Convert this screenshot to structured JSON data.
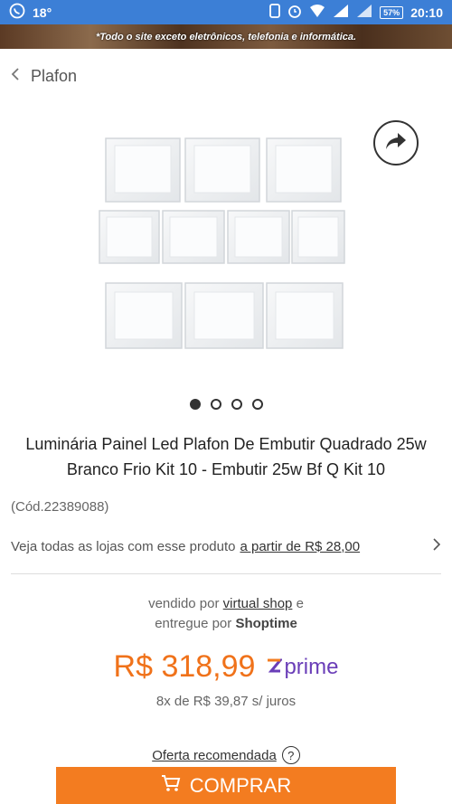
{
  "status_bar": {
    "temperature": "18°",
    "battery": "57%",
    "time": "20:10"
  },
  "banner": {
    "text": "*Todo o site exceto eletrônicos, telefonia e informática."
  },
  "header": {
    "back_label": "Plafon"
  },
  "product": {
    "title": "Luminária Painel Led Plafon De Embutir Quadrado 25w Branco Frio Kit 10 - Embutir 25w Bf Q Kit 10",
    "code": "(Cód.22389088)",
    "stores_text": "Veja todas as lojas com esse produto",
    "stores_link": "a partir de R$ 28,00",
    "image_count": 4,
    "active_image": 1
  },
  "seller": {
    "sold_by_label": "vendido por",
    "sold_by_name": "virtual shop",
    "delivered_label": "e",
    "delivered_by_label": "entregue por",
    "delivered_by_name": "Shoptime"
  },
  "pricing": {
    "price": "R$ 318,99",
    "prime_label": "prime",
    "installments": "8x de R$ 39,87 s/ juros"
  },
  "offer": {
    "label": "Oferta recomendada",
    "help_icon_text": "?"
  },
  "buy_button": {
    "label": "COMPRAR"
  },
  "colors": {
    "status_bar": "#3c7fd6",
    "accent": "#f37c20",
    "price": "#f0721a",
    "prime": "#6a3eb8"
  }
}
